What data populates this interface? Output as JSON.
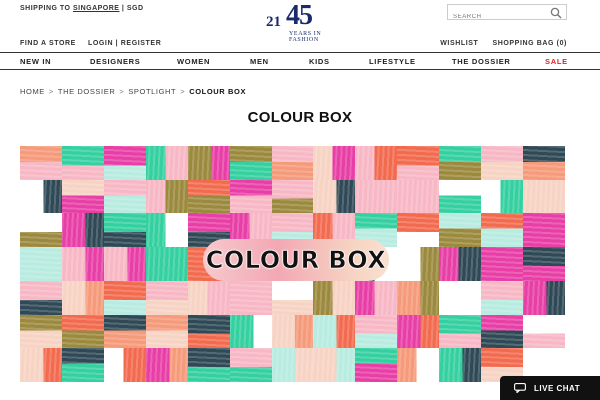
{
  "header": {
    "shipping_prefix": "SHIPPING TO",
    "shipping_country": "SINGAPORE",
    "shipping_suffix": "| SGD",
    "find_store": "FIND A STORE",
    "login_register": "LOGIN | REGISTER",
    "logo_num_small": "21",
    "logo_num_large": "45",
    "logo_tag_line1": "YEARS IN",
    "logo_tag_line2": "FASHION",
    "search_placeholder": "SEARCH",
    "wishlist": "WISHLIST",
    "shopping_bag": "SHOPPING BAG (0)"
  },
  "nav": {
    "items": [
      {
        "label": "NEW IN"
      },
      {
        "label": "DESIGNERS"
      },
      {
        "label": "WOMEN"
      },
      {
        "label": "MEN"
      },
      {
        "label": "KIDS"
      },
      {
        "label": "LIFESTYLE"
      },
      {
        "label": "THE DOSSIER"
      },
      {
        "label": "SALE"
      }
    ],
    "sale_color": "#d9262c"
  },
  "breadcrumb": {
    "items": [
      "HOME",
      "THE DOSSIER",
      "SPOTLIGHT",
      "COLOUR BOX"
    ],
    "separator": ">"
  },
  "page": {
    "title": "COLOUR BOX",
    "banner_text": "COLOUR BOX"
  },
  "chat": {
    "label": "LIVE CHAT"
  },
  "colors": {
    "brand_navy": "#1b2a6b",
    "banner_palette": [
      "#e83fa6",
      "#f26b4f",
      "#35d0a0",
      "#2f4a56",
      "#f7b7c4",
      "#f59a7a",
      "#9b8a3e",
      "#ffffff",
      "#b8ece0",
      "#f7d3c4"
    ]
  }
}
